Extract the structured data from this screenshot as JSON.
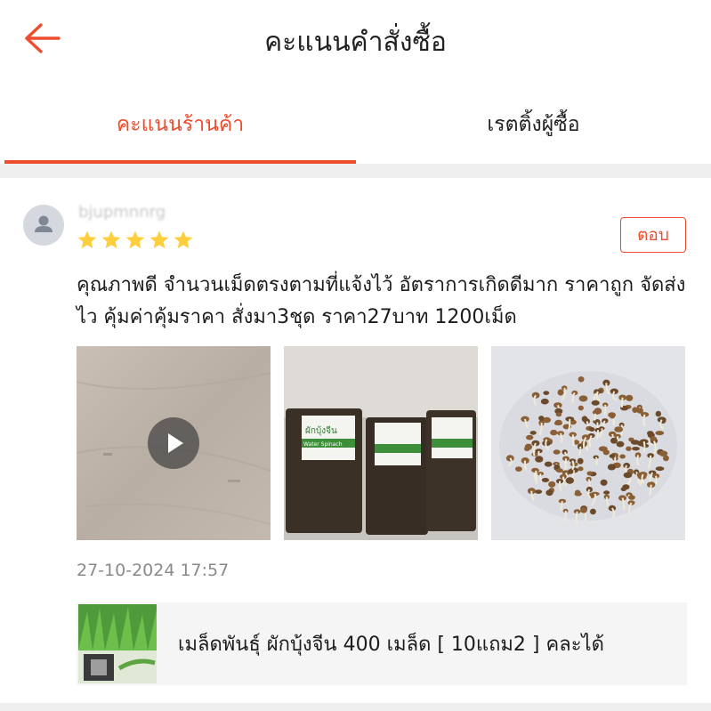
{
  "header": {
    "title": "คะแนนคำสั่งซื้อ",
    "back_icon": "arrow-left-icon",
    "accent": "#ee4d2d"
  },
  "tabs": [
    {
      "label": "คะแนนร้านค้า",
      "active": true
    },
    {
      "label": "เรตติ้งผู้ซื้อ",
      "active": false
    }
  ],
  "review": {
    "username": "bjupmnnrg",
    "rating": 5,
    "reply_label": "ตอบ",
    "text": "คุณภาพดี จำนวนเม็ดตรงตามที่แจ้งไว้ อัตราการเกิดดีมาก ราคาถูก จัดส่งไว คุ้มค่าคุ้มราคา สั่งมา3ชุด ราคา27บาท 1200เม็ด",
    "media": [
      {
        "kind": "video"
      },
      {
        "kind": "photo",
        "packet_label": "ผักบุ้งจีน",
        "packet_sublabel": "Water Spinach"
      },
      {
        "kind": "photo"
      }
    ],
    "timestamp": "27-10-2024 17:57",
    "product": {
      "name": "เมล็ดพันธุ์ ผักบุ้งจีน 400 เมล็ด [ 10แถม2 ] คละได้"
    }
  }
}
